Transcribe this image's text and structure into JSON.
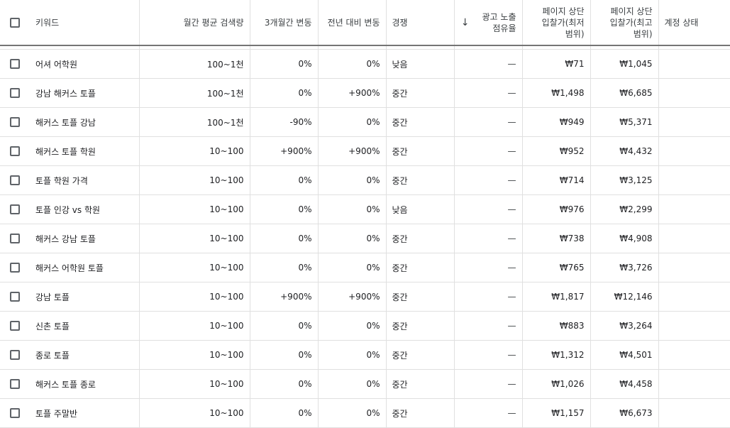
{
  "header": {
    "keyword": "키워드",
    "monthly_search": "월간 평균 검색량",
    "three_month_change": "3개월간 변동",
    "yoy_change": "전년 대비 변동",
    "competition": "경쟁",
    "impression_share": "광고 노출 점유율",
    "top_bid_low": "페이지 상단 입찰가(최저 범위)",
    "top_bid_high": "페이지 상단 입찰가(최고 범위)",
    "account_status": "계정 상태",
    "sort_icon": "arrow-down-icon"
  },
  "rows": [
    {
      "keyword": "어셔 어학원",
      "volume": "100~1천",
      "three": "0%",
      "yoy": "0%",
      "competition": "낮음",
      "share": "—",
      "low": "₩71",
      "high": "₩1,045",
      "status": ""
    },
    {
      "keyword": "강남 해커스 토플",
      "volume": "100~1천",
      "three": "0%",
      "yoy": "+900%",
      "competition": "중간",
      "share": "—",
      "low": "₩1,498",
      "high": "₩6,685",
      "status": ""
    },
    {
      "keyword": "해커스 토플 강남",
      "volume": "100~1천",
      "three": "-90%",
      "yoy": "0%",
      "competition": "중간",
      "share": "—",
      "low": "₩949",
      "high": "₩5,371",
      "status": ""
    },
    {
      "keyword": "해커스 토플 학원",
      "volume": "10~100",
      "three": "+900%",
      "yoy": "+900%",
      "competition": "중간",
      "share": "—",
      "low": "₩952",
      "high": "₩4,432",
      "status": ""
    },
    {
      "keyword": "토플 학원 가격",
      "volume": "10~100",
      "three": "0%",
      "yoy": "0%",
      "competition": "중간",
      "share": "—",
      "low": "₩714",
      "high": "₩3,125",
      "status": ""
    },
    {
      "keyword": "토플 인강 vs 학원",
      "volume": "10~100",
      "three": "0%",
      "yoy": "0%",
      "competition": "낮음",
      "share": "—",
      "low": "₩976",
      "high": "₩2,299",
      "status": ""
    },
    {
      "keyword": "해커스 강남 토플",
      "volume": "10~100",
      "three": "0%",
      "yoy": "0%",
      "competition": "중간",
      "share": "—",
      "low": "₩738",
      "high": "₩4,908",
      "status": ""
    },
    {
      "keyword": "해커스 어학원 토플",
      "volume": "10~100",
      "three": "0%",
      "yoy": "0%",
      "competition": "중간",
      "share": "—",
      "low": "₩765",
      "high": "₩3,726",
      "status": ""
    },
    {
      "keyword": "강남 토플",
      "volume": "10~100",
      "three": "+900%",
      "yoy": "+900%",
      "competition": "중간",
      "share": "—",
      "low": "₩1,817",
      "high": "₩12,146",
      "status": ""
    },
    {
      "keyword": "신촌 토플",
      "volume": "10~100",
      "three": "0%",
      "yoy": "0%",
      "competition": "중간",
      "share": "—",
      "low": "₩883",
      "high": "₩3,264",
      "status": ""
    },
    {
      "keyword": "종로 토플",
      "volume": "10~100",
      "three": "0%",
      "yoy": "0%",
      "competition": "중간",
      "share": "—",
      "low": "₩1,312",
      "high": "₩4,501",
      "status": ""
    },
    {
      "keyword": "해커스 토플 종로",
      "volume": "10~100",
      "three": "0%",
      "yoy": "0%",
      "competition": "중간",
      "share": "—",
      "low": "₩1,026",
      "high": "₩4,458",
      "status": ""
    },
    {
      "keyword": "토플 주말반",
      "volume": "10~100",
      "three": "0%",
      "yoy": "0%",
      "competition": "중간",
      "share": "—",
      "low": "₩1,157",
      "high": "₩6,673",
      "status": ""
    }
  ]
}
